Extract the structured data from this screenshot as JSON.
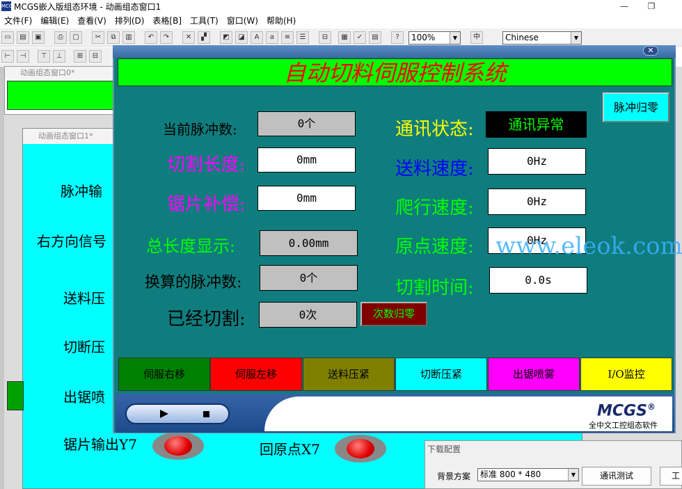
{
  "window": {
    "title": "MCGS嵌入版组态环境 - 动画组态窗口1",
    "app_icon_text": "MCGS"
  },
  "menu": [
    "文件(F)",
    "编辑(E)",
    "查看(V)",
    "排列(D)",
    "表格[B]",
    "工具(T)",
    "窗口(W)",
    "帮助(H)"
  ],
  "toolbar": {
    "zoom": "100%",
    "language": "Chinese"
  },
  "background_windows": {
    "win0_title": "动画组态窗口0*",
    "win1_title": "动画组态窗口1*",
    "labels": [
      "脉冲输",
      "右方向信号",
      "送料压",
      "切断压",
      "出锯喷",
      "锯片输出Y7",
      "回原点X7"
    ]
  },
  "panel": {
    "title": "自动切料伺服控制系统",
    "pulse_reset": "脉冲归零",
    "count_reset": "次数归零",
    "left_fields": [
      {
        "label": "当前脉冲数:",
        "value": "0个",
        "label_color": "#000000"
      },
      {
        "label": "切割长度:",
        "value": "0mm",
        "label_color": "#ff00ff"
      },
      {
        "label": "锯片补偿:",
        "value": "0mm",
        "label_color": "#ff00ff"
      },
      {
        "label": "总长度显示:",
        "value": "0.00mm",
        "label_color": "#00ff00"
      },
      {
        "label": "换算的脉冲数:",
        "value": "0个",
        "label_color": "#000000"
      },
      {
        "label": "已经切割:",
        "value": "0次",
        "label_color": "#000000"
      }
    ],
    "right_fields": [
      {
        "label": "通讯状态:",
        "value": "通讯异常",
        "label_color": "#ffff00"
      },
      {
        "label": "送料速度:",
        "value": "0Hz",
        "label_color": "#0000ff"
      },
      {
        "label": "爬行速度:",
        "value": "0Hz",
        "label_color": "#00ff00"
      },
      {
        "label": "原点速度:",
        "value": "0Hz",
        "label_color": "#00ff00"
      },
      {
        "label": "切割时间:",
        "value": "0.0s",
        "label_color": "#00ff00"
      }
    ],
    "nav_buttons": [
      {
        "label": "伺服右移",
        "bg": "#008000"
      },
      {
        "label": "伺服左移",
        "bg": "#ff0000"
      },
      {
        "label": "送料压紧",
        "bg": "#808000"
      },
      {
        "label": "切断压紧",
        "bg": "#00ffff"
      },
      {
        "label": "出锯喷雾",
        "bg": "#ff00ff"
      },
      {
        "label": "I/O监控",
        "bg": "#ffff00"
      }
    ],
    "logo": "MCGS",
    "logo_mark": "®",
    "logo_sub": "全中文工控组态软件",
    "watermark": "www.eleok.com"
  },
  "download_dialog": {
    "title": "下载配置",
    "scheme_label": "背景方案",
    "scheme_value": "标准 800 * 480",
    "comm_test": "通讯测试",
    "cut_button": "工"
  }
}
